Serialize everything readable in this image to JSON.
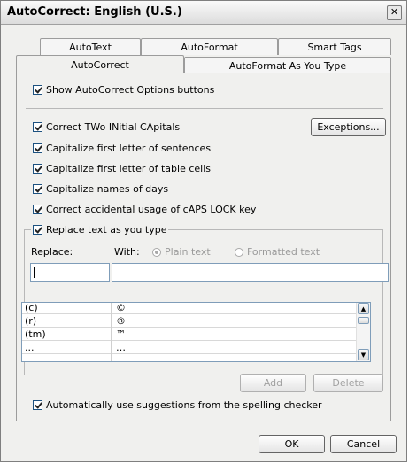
{
  "window": {
    "title": "AutoCorrect: English (U.S.)",
    "close_glyph": "✕"
  },
  "tabs": {
    "back": [
      {
        "label": "AutoText"
      },
      {
        "label": "AutoFormat"
      },
      {
        "label": "Smart Tags"
      }
    ],
    "front": [
      {
        "label": "AutoCorrect",
        "active": true
      },
      {
        "label": "AutoFormat As You Type",
        "active": false
      }
    ]
  },
  "options": {
    "show_buttons": "Show AutoCorrect Options buttons",
    "two_initials": "Correct TWo INitial CApitals",
    "exceptions_button": "Exceptions...",
    "capitalize_sentences": "Capitalize first letter of sentences",
    "capitalize_table_cells": "Capitalize first letter of table cells",
    "capitalize_days": "Capitalize names of days",
    "caps_lock": "Correct accidental usage of cAPS LOCK key"
  },
  "replace_group": {
    "label": "Replace text as you type",
    "replace_label": "Replace:",
    "with_label": "With:",
    "plain_text": "Plain text",
    "formatted_text": "Formatted text",
    "replace_value": "",
    "with_value": ""
  },
  "entries": [
    {
      "replace": "(c)",
      "with": "©"
    },
    {
      "replace": "(r)",
      "with": "®"
    },
    {
      "replace": "(tm)",
      "with": "™"
    },
    {
      "replace": "...",
      "with": "…"
    }
  ],
  "buttons": {
    "add": "Add",
    "delete": "Delete",
    "ok": "OK",
    "cancel": "Cancel"
  },
  "suggestions": "Automatically use suggestions from the spelling checker"
}
